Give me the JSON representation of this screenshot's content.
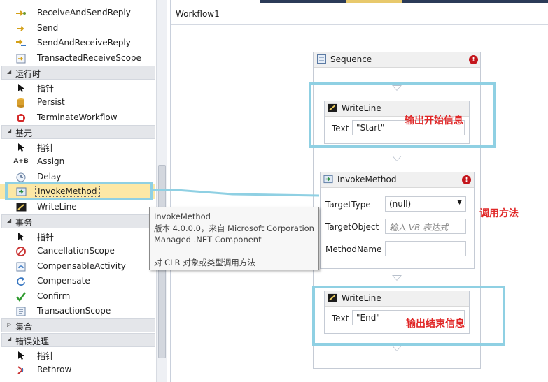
{
  "toolbox": {
    "items_top": [
      {
        "label": "ReceiveAndSendReply",
        "icon": "receive-send-reply-icon"
      },
      {
        "label": "Send",
        "icon": "send-icon"
      },
      {
        "label": "SendAndReceiveReply",
        "icon": "send-receive-reply-icon"
      },
      {
        "label": "TransactedReceiveScope",
        "icon": "transacted-receive-scope-icon"
      }
    ],
    "categories": [
      {
        "label": "运行时",
        "expanded": true
      },
      {
        "label": "基元",
        "expanded": true
      },
      {
        "label": "事务",
        "expanded": true
      },
      {
        "label": "集合",
        "expanded": false
      },
      {
        "label": "错误处理",
        "expanded": true
      }
    ],
    "runtime_items": [
      {
        "label": "指针",
        "icon": "pointer-icon"
      },
      {
        "label": "Persist",
        "icon": "persist-icon"
      },
      {
        "label": "TerminateWorkflow",
        "icon": "terminate-workflow-icon"
      }
    ],
    "primitives_items": [
      {
        "label": "指针",
        "icon": "pointer-icon"
      },
      {
        "label": "Assign",
        "icon": "assign-icon",
        "glyph": "A+B"
      },
      {
        "label": "Delay",
        "icon": "delay-icon"
      },
      {
        "label": "InvokeMethod",
        "icon": "invoke-method-icon",
        "selected": true
      },
      {
        "label": "WriteLine",
        "icon": "writeline-icon"
      }
    ],
    "transaction_items": [
      {
        "label": "指针",
        "icon": "pointer-icon"
      },
      {
        "label": "CancellationScope",
        "icon": "cancellation-scope-icon"
      },
      {
        "label": "CompensableActivity",
        "icon": "compensable-activity-icon"
      },
      {
        "label": "Compensate",
        "icon": "compensate-icon"
      },
      {
        "label": "Confirm",
        "icon": "confirm-icon"
      },
      {
        "label": "TransactionScope",
        "icon": "transaction-scope-icon"
      }
    ],
    "error_items": [
      {
        "label": "指针",
        "icon": "pointer-icon"
      },
      {
        "label": "Rethrow",
        "icon": "rethrow-icon"
      }
    ]
  },
  "tooltip": {
    "title": "InvokeMethod",
    "version": "版本 4.0.0.0，来自 Microsoft Corporation",
    "component": "Managed .NET Component",
    "description": "对 CLR 对象或类型调用方法"
  },
  "designer": {
    "breadcrumb": "Workflow1",
    "sequence": {
      "title": "Sequence",
      "icon": "sequence-icon"
    },
    "writeline1": {
      "title": "WriteLine",
      "text_label": "Text",
      "text_value": "\"Start\"",
      "annotation": "输出开始信息"
    },
    "invoke": {
      "title": "InvokeMethod",
      "target_type_label": "TargetType",
      "target_type_value": "(null)",
      "target_object_label": "TargetObject",
      "target_object_placeholder": "输入 VB 表达式",
      "method_name_label": "MethodName",
      "method_name_value": "",
      "annotation": "调用方法"
    },
    "writeline2": {
      "title": "WriteLine",
      "text_label": "Text",
      "text_value": "\"End\"",
      "annotation": "输出结束信息"
    }
  },
  "colors": {
    "highlight_box": "#8fd0e3",
    "annotation_text": "#e02828",
    "error_badge": "#c4161c",
    "selected_item": "#fce8a6"
  }
}
